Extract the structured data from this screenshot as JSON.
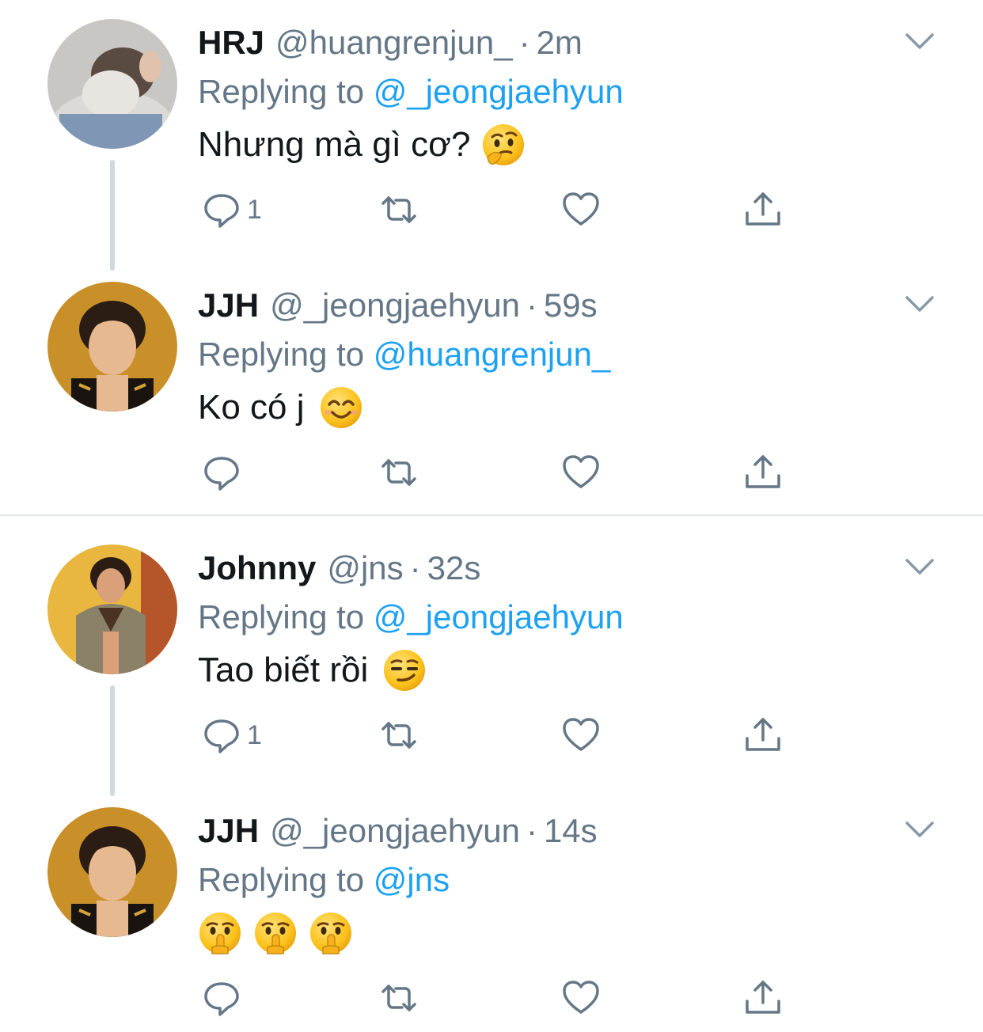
{
  "colors": {
    "text": "#14171a",
    "secondary": "#657786",
    "link": "#1da1f2",
    "thread_line": "#cfd9de",
    "separator": "#e1e8ed"
  },
  "tweets": [
    {
      "name": "HRJ",
      "handle": "@huangrenjun_",
      "dot": "·",
      "time": "2m",
      "replying_prefix": "Replying to",
      "replying_to": "@_jeongjaehyun",
      "text": "Nhưng mà gì cơ?",
      "emojis": [
        "thinking-face-emoji"
      ],
      "reply_count": "1",
      "avatar": "avatar-hrj"
    },
    {
      "name": "JJH",
      "handle": "@_jeongjaehyun",
      "dot": "·",
      "time": "59s",
      "replying_prefix": "Replying to",
      "replying_to": "@huangrenjun_",
      "text": "Ko có j",
      "emojis": [
        "smiling-face-emoji"
      ],
      "reply_count": "",
      "avatar": "avatar-jjh"
    },
    {
      "name": "Johnny",
      "handle": "@jns",
      "dot": "·",
      "time": "32s",
      "replying_prefix": "Replying to",
      "replying_to": "@_jeongjaehyun",
      "text": "Tao biết rồi",
      "emojis": [
        "smirking-face-emoji"
      ],
      "reply_count": "1",
      "avatar": "avatar-johnny"
    },
    {
      "name": "JJH",
      "handle": "@_jeongjaehyun",
      "dot": "·",
      "time": "14s",
      "replying_prefix": "Replying to",
      "replying_to": "@jns",
      "text": "",
      "emojis": [
        "shushing-face-emoji",
        "shushing-face-emoji",
        "shushing-face-emoji"
      ],
      "reply_count": "",
      "avatar": "avatar-jjh"
    }
  ],
  "icons": {
    "reply": "reply-icon",
    "retweet": "retweet-icon",
    "like": "like-icon",
    "share": "share-icon",
    "more": "chevron-down-icon"
  }
}
